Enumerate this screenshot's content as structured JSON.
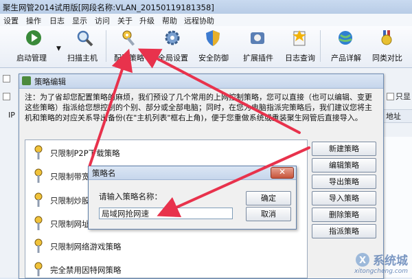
{
  "window": {
    "title": "聚生网管2014试用版[网段名称:VLAN_20150119181358]"
  },
  "menu": [
    "设置",
    "操作",
    "日志",
    "显示",
    "访问",
    "关于",
    "升级",
    "帮助",
    "远程协助"
  ],
  "toolbar": {
    "items": [
      "启动管理",
      "扫描主机",
      "配置策略",
      "全局设置",
      "安全防御",
      "扩展插件",
      "日志查询",
      "产品详解",
      "同类对比"
    ]
  },
  "background": {
    "checkbox_label": "只显",
    "column_header": "地址",
    "col_left": "IP"
  },
  "policy_dialog": {
    "title": "策略编辑",
    "note": "注：为了省却您配置策略的麻烦，我们预设了几个常用的上网控制策略，您可以直接（也可以编辑、变更这些策略）指派给您想控制的个别、部分或全部电脑；同时，在您为电脑指派完策略后，我们建议您将主机和策略的对应关系导出备份(在\"主机列表\"框右上角)，便于您重做系统或重装聚生网管后直接导入。",
    "policies": [
      "只限制P2P下载策略",
      "只限制带宽",
      "只限制炒股软",
      "只限制网址访",
      "只限制网络游戏策略",
      "完全禁用因特网策略"
    ],
    "buttons": [
      "新建策略",
      "编辑策略",
      "导出策略",
      "导入策略",
      "删除策略",
      "指派策略"
    ]
  },
  "name_dialog": {
    "title": "策略名",
    "prompt": "请输入策略名称：",
    "input_value": "局域网抢网速",
    "ok_label": "确定",
    "cancel_label": "取消"
  },
  "watermark": {
    "brand": "系统城",
    "url": "xitongcheng.com"
  },
  "colors": {
    "arrow": "#e8324c",
    "accent": "#4a76b0"
  }
}
